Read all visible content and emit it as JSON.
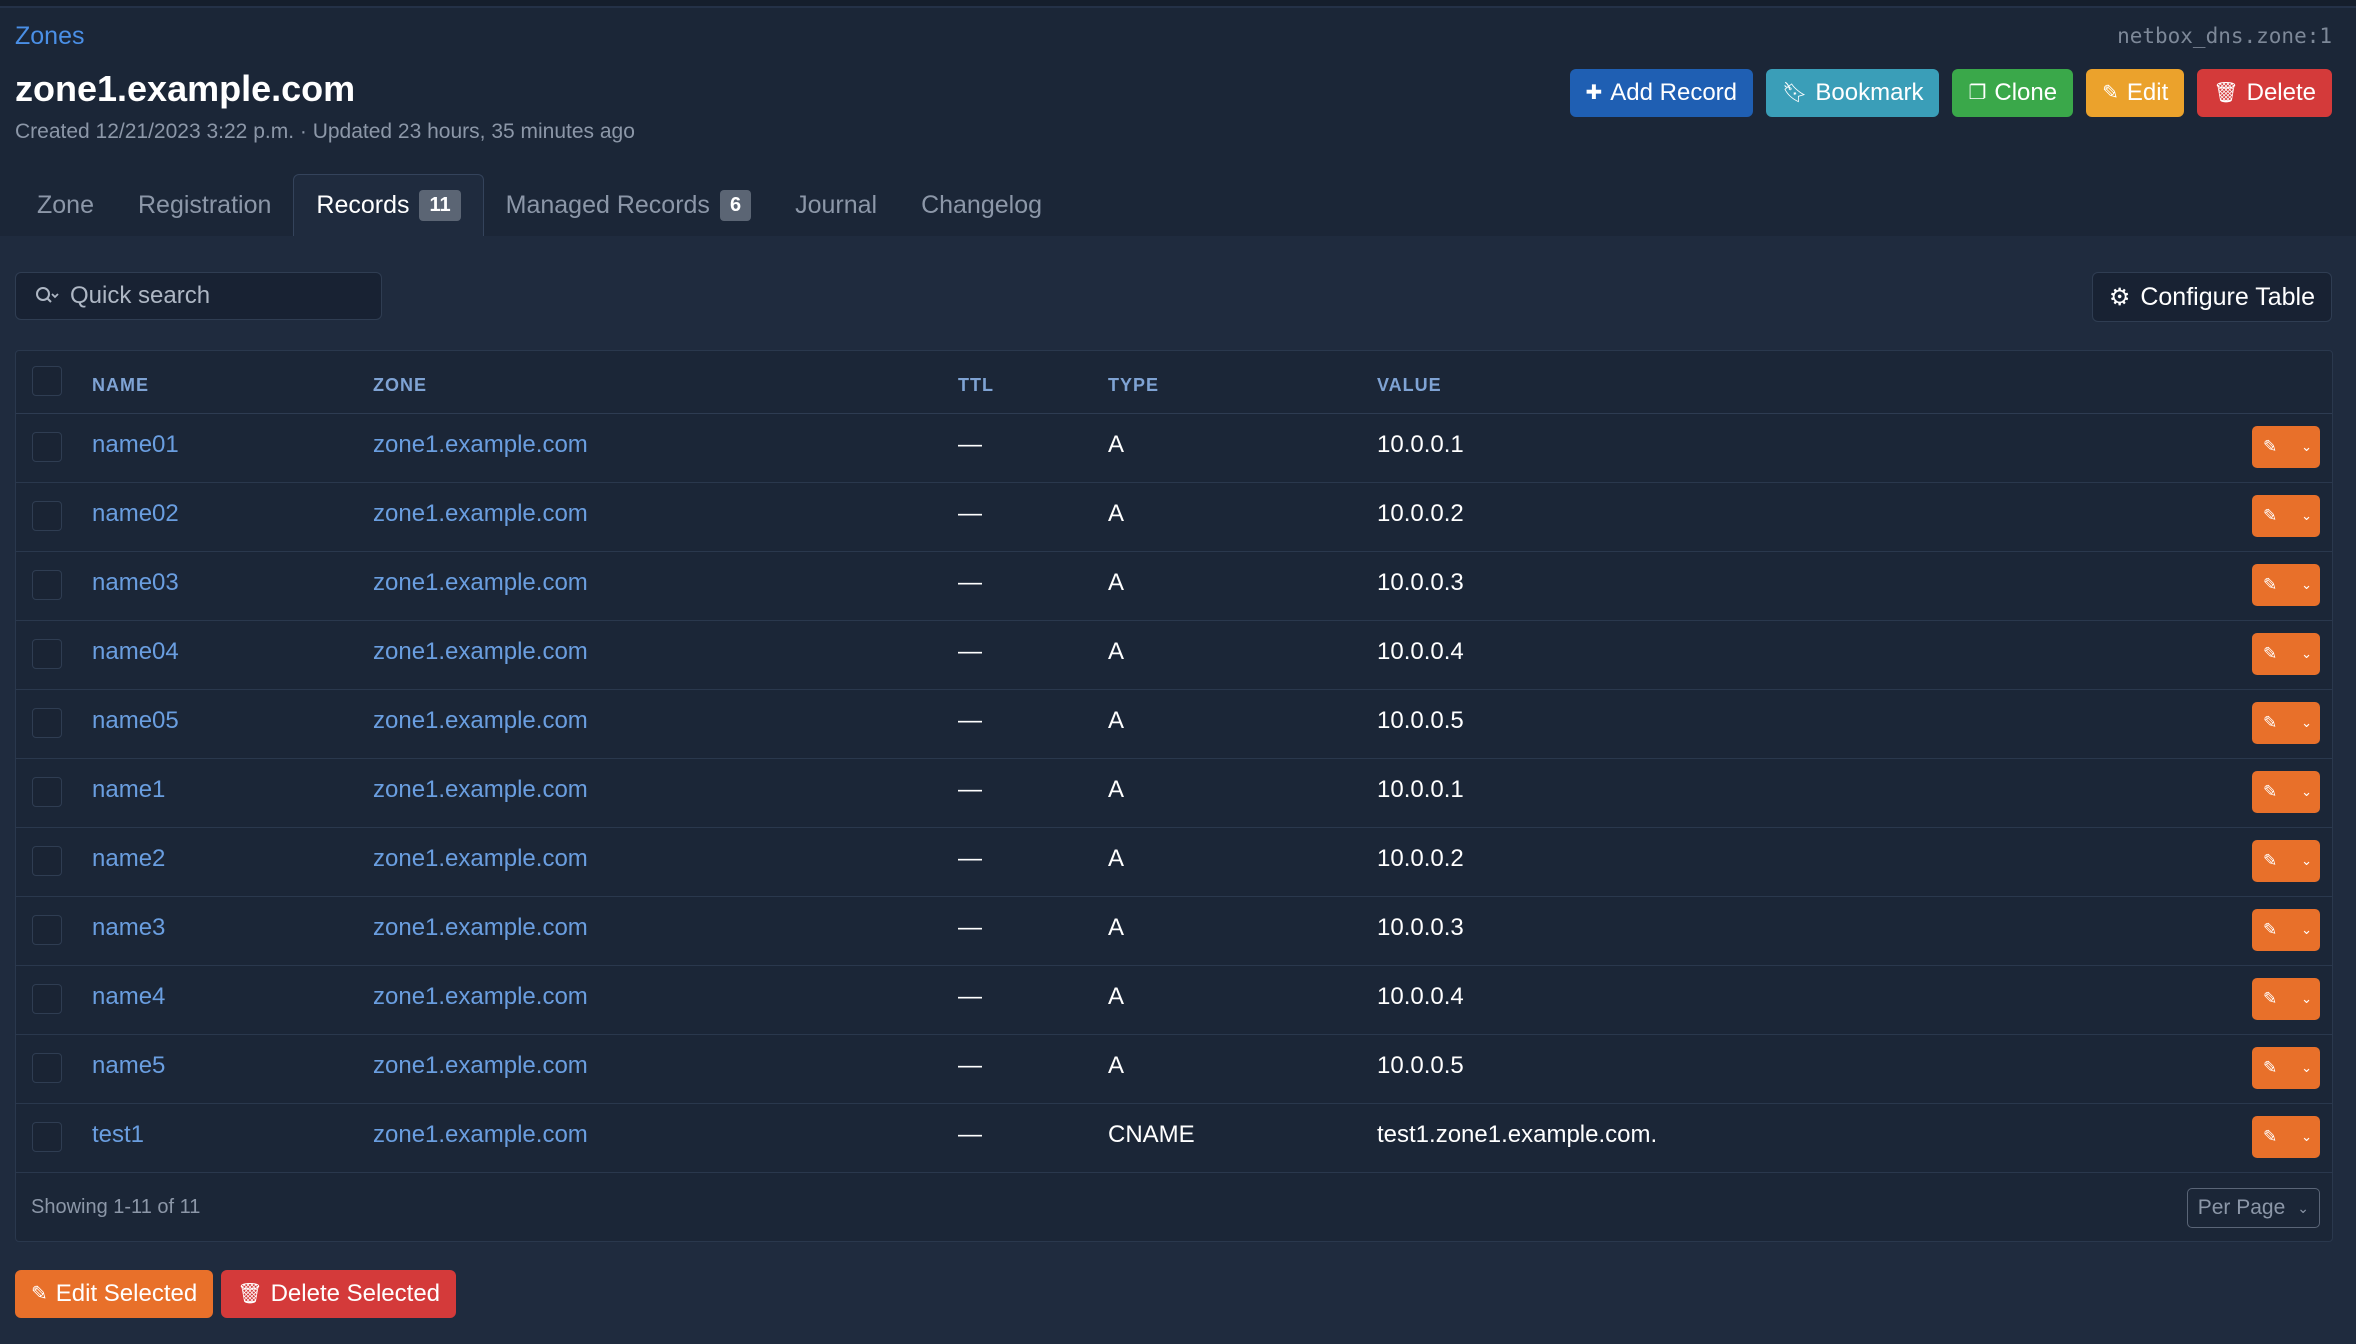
{
  "breadcrumb": "Zones",
  "object_id": "netbox_dns.zone:1",
  "title": "zone1.example.com",
  "meta": "Created 12/21/2023 3:22 p.m. · Updated 23 hours, 35 minutes ago",
  "actions": {
    "add_record": "Add Record",
    "bookmark": "Bookmark",
    "clone": "Clone",
    "edit": "Edit",
    "delete": "Delete"
  },
  "tabs": [
    {
      "label": "Zone"
    },
    {
      "label": "Registration"
    },
    {
      "label": "Records",
      "badge": "11"
    },
    {
      "label": "Managed Records",
      "badge": "6"
    },
    {
      "label": "Journal"
    },
    {
      "label": "Changelog"
    }
  ],
  "search": {
    "placeholder": "Quick search"
  },
  "configure_table": "Configure Table",
  "table": {
    "columns": [
      "NAME",
      "ZONE",
      "TTL",
      "TYPE",
      "VALUE"
    ],
    "rows": [
      {
        "name": "name01",
        "zone": "zone1.example.com",
        "ttl": "—",
        "type": "A",
        "value": "10.0.0.1"
      },
      {
        "name": "name02",
        "zone": "zone1.example.com",
        "ttl": "—",
        "type": "A",
        "value": "10.0.0.2"
      },
      {
        "name": "name03",
        "zone": "zone1.example.com",
        "ttl": "—",
        "type": "A",
        "value": "10.0.0.3"
      },
      {
        "name": "name04",
        "zone": "zone1.example.com",
        "ttl": "—",
        "type": "A",
        "value": "10.0.0.4"
      },
      {
        "name": "name05",
        "zone": "zone1.example.com",
        "ttl": "—",
        "type": "A",
        "value": "10.0.0.5"
      },
      {
        "name": "name1",
        "zone": "zone1.example.com",
        "ttl": "—",
        "type": "A",
        "value": "10.0.0.1"
      },
      {
        "name": "name2",
        "zone": "zone1.example.com",
        "ttl": "—",
        "type": "A",
        "value": "10.0.0.2"
      },
      {
        "name": "name3",
        "zone": "zone1.example.com",
        "ttl": "—",
        "type": "A",
        "value": "10.0.0.3"
      },
      {
        "name": "name4",
        "zone": "zone1.example.com",
        "ttl": "—",
        "type": "A",
        "value": "10.0.0.4"
      },
      {
        "name": "name5",
        "zone": "zone1.example.com",
        "ttl": "—",
        "type": "A",
        "value": "10.0.0.5"
      },
      {
        "name": "test1",
        "zone": "zone1.example.com",
        "ttl": "—",
        "type": "CNAME",
        "value": "test1.zone1.example.com."
      }
    ]
  },
  "footer": {
    "showing": "Showing 1-11 of 11",
    "per_page": "Per Page"
  },
  "bulk": {
    "edit_selected": "Edit Selected",
    "delete_selected": "Delete Selected"
  },
  "colors": {
    "background": "#1b2637",
    "link": "#6a9ee0",
    "primary": "#1f5fb3",
    "info": "#3a9eb8",
    "success": "#3aa84a",
    "warning": "#eba22c",
    "danger": "#d43a3a",
    "orange": "#e8702a"
  }
}
